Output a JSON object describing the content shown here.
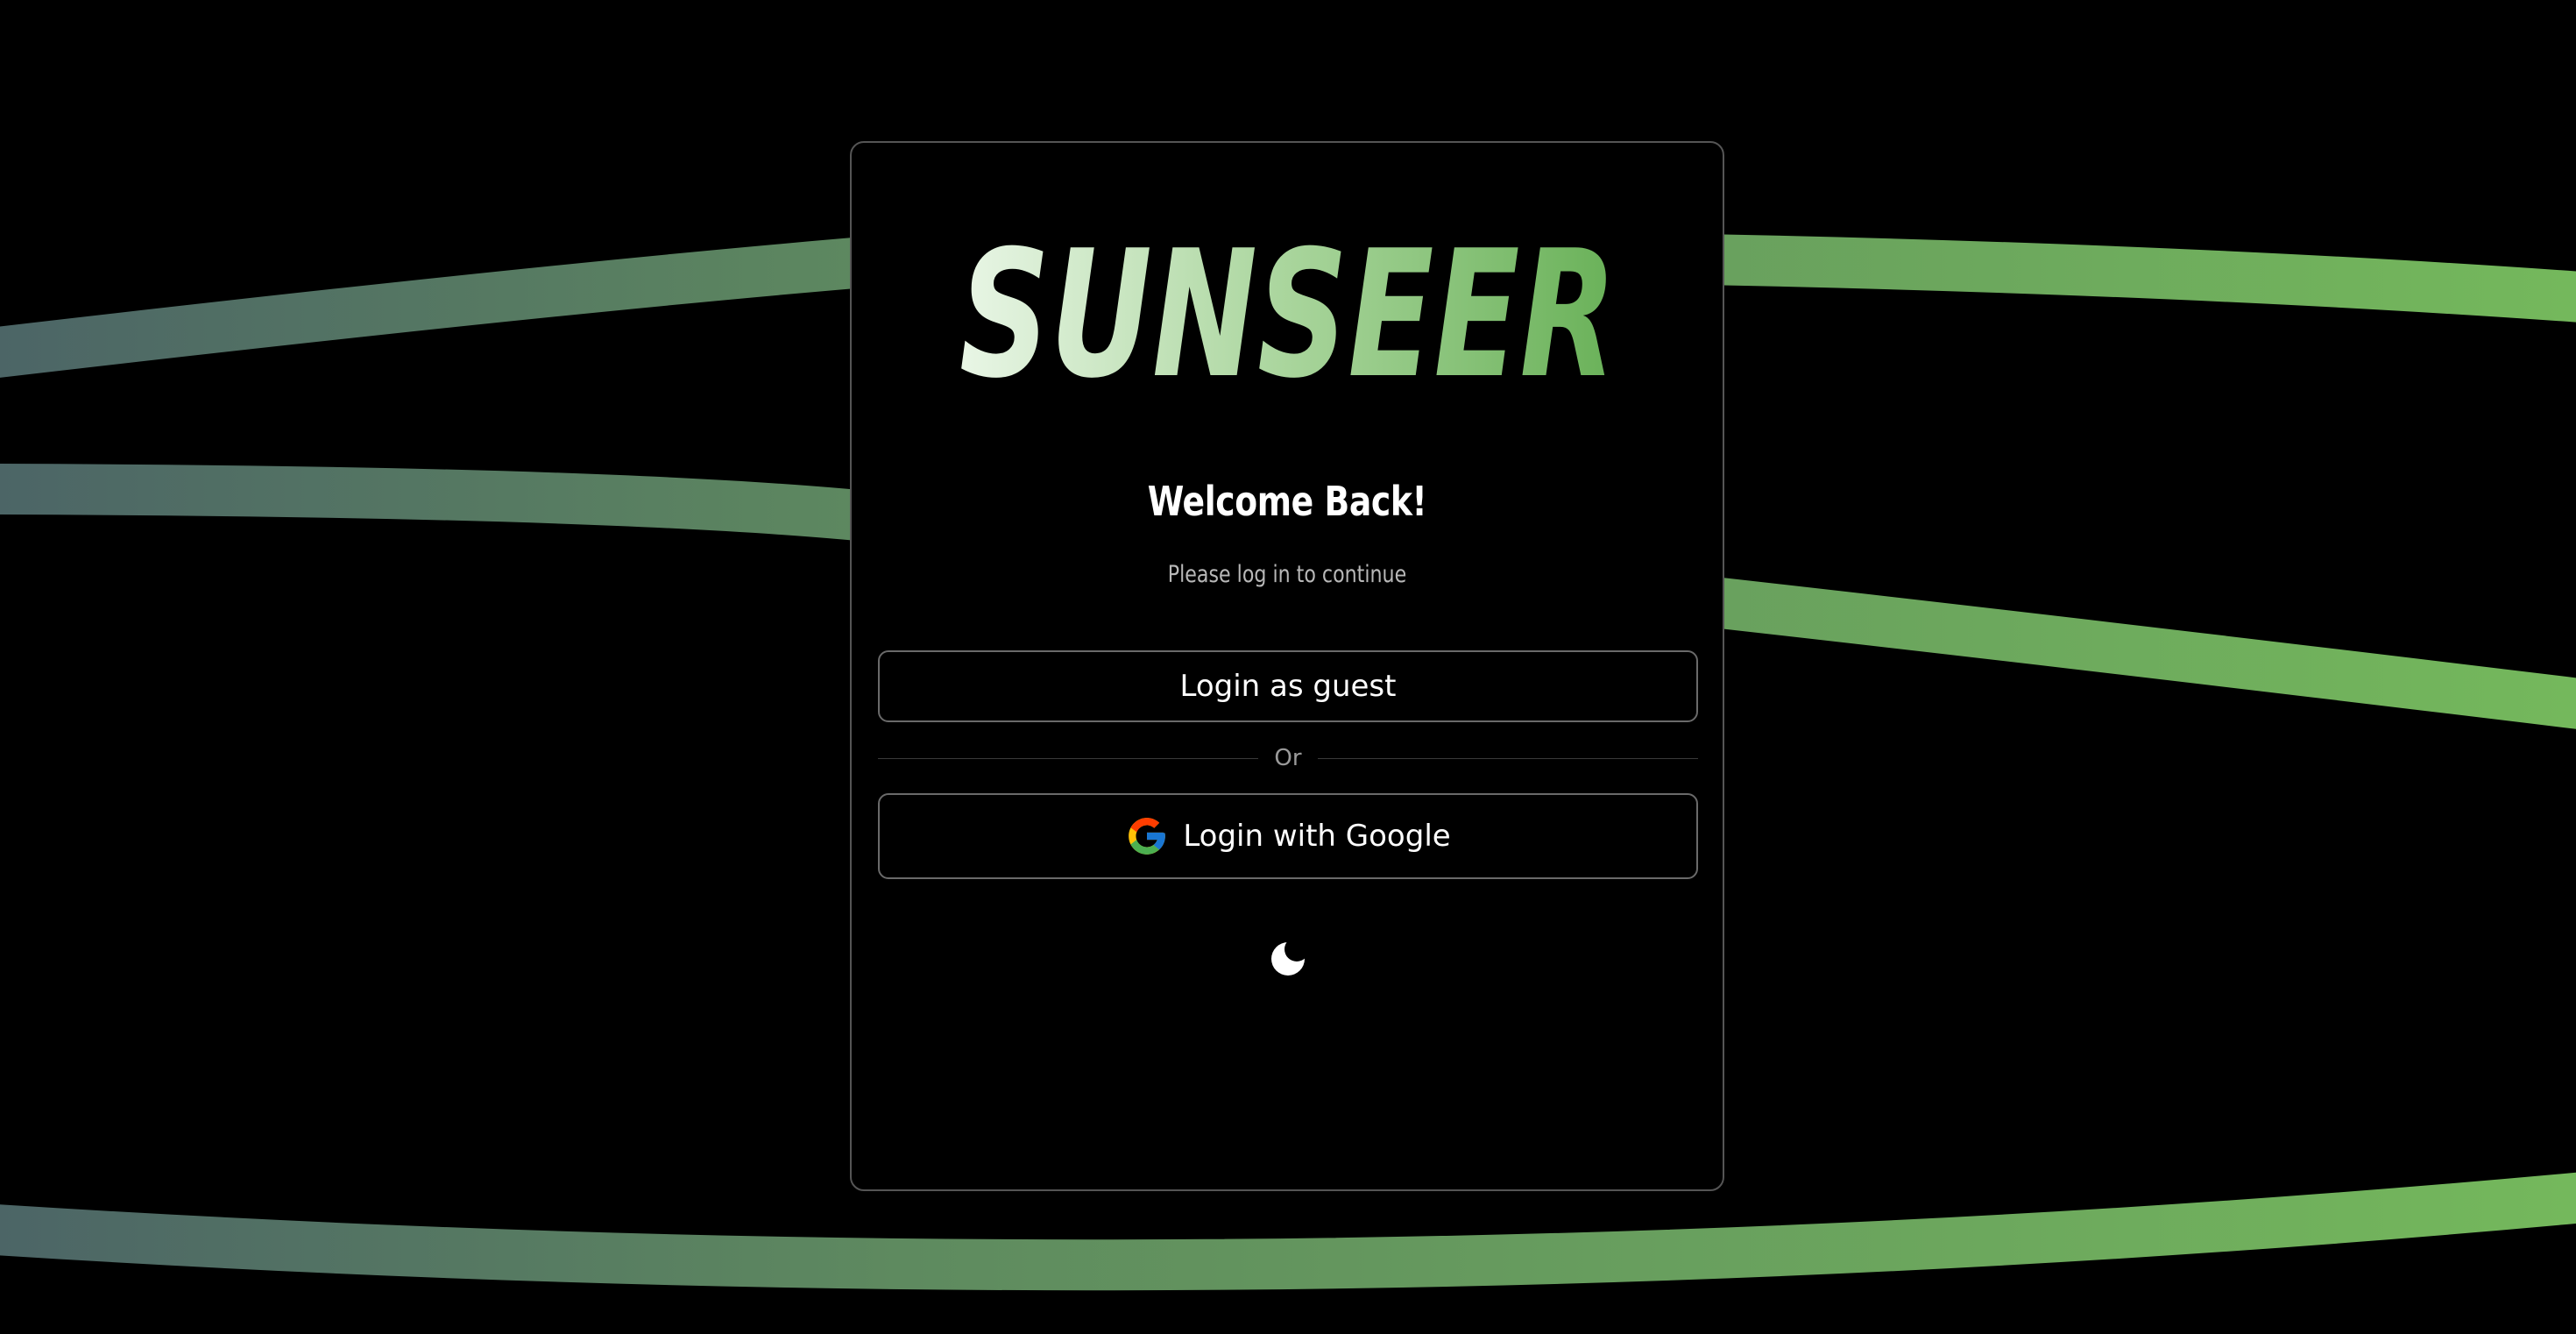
{
  "brand": {
    "name": "SUNSEER",
    "gradient_start": "#e9f6e6",
    "gradient_end": "#69b158"
  },
  "background": {
    "color": "#000000",
    "wave_color_left": "#4c6566",
    "wave_color_right": "#74b85c"
  },
  "login": {
    "title": "Welcome Back!",
    "subtitle": "Please log in to continue",
    "guest_button_label": "Login as guest",
    "divider_label": "Or",
    "google_button_label": "Login with Google"
  },
  "icons": {
    "google": "google-logo-icon",
    "theme_toggle": "moon-icon"
  }
}
